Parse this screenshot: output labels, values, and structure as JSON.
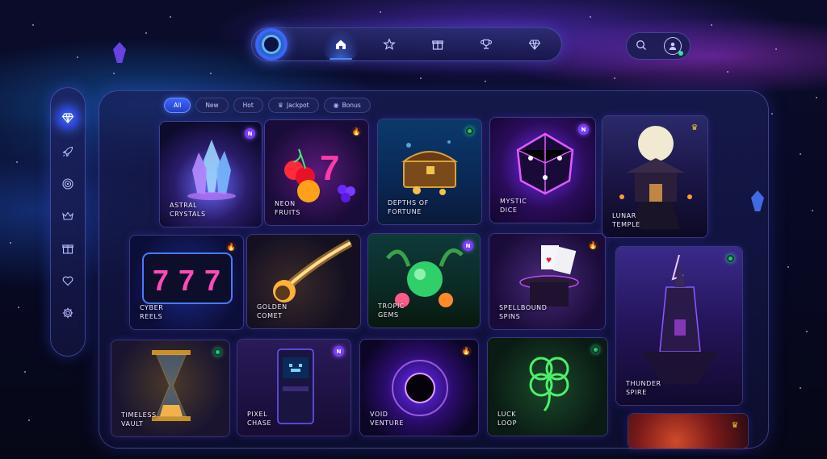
{
  "nav": {
    "items": [
      {
        "name": "home",
        "icon": "home-icon",
        "active": true
      },
      {
        "name": "favorites",
        "icon": "star-icon"
      },
      {
        "name": "gifts",
        "icon": "gift-icon"
      },
      {
        "name": "trophy",
        "icon": "trophy-icon"
      },
      {
        "name": "diamond",
        "icon": "diamond-icon"
      }
    ],
    "right": [
      "search-icon",
      "user-icon"
    ]
  },
  "sidebar": {
    "items": [
      "diamond-icon",
      "rocket-icon",
      "target-icon",
      "crown-icon",
      "gift-icon",
      "heart-icon",
      "gear-icon"
    ]
  },
  "filters": [
    {
      "label": "All",
      "active": true
    },
    {
      "label": "New"
    },
    {
      "label": "Hot"
    },
    {
      "label": "Jackpot",
      "icon": "crown-icon"
    },
    {
      "label": "Bonus",
      "icon": "coin-icon"
    }
  ],
  "games": [
    {
      "title": "ASTRAL\nCRYSTALS",
      "badge": "N",
      "badge_type": "new",
      "accent": "#6a6bff"
    },
    {
      "title": "NEON\nFRUITS",
      "badge": "🔥",
      "badge_type": "hot",
      "accent": "#ff3aa8"
    },
    {
      "title": "DEPTHS OF\nFORTUNE",
      "badge": "",
      "badge_type": "live",
      "accent": "#2a8bd8"
    },
    {
      "title": "MYSTIC\nDICE",
      "badge": "N",
      "badge_type": "new",
      "accent": "#b44bff"
    },
    {
      "title": "LUNAR\nTEMPLE",
      "badge": "♛",
      "badge_type": "crown",
      "accent": "#7a6bd0"
    },
    {
      "title": "CYBER\nREELS",
      "badge": "🔥",
      "badge_type": "hot",
      "accent": "#3a6bff"
    },
    {
      "title": "GOLDEN\nCOMET",
      "badge": "",
      "badge_type": "none",
      "accent": "#ffb23a"
    },
    {
      "title": "TROPIC\nGEMS",
      "badge": "N",
      "badge_type": "new",
      "accent": "#2fd06a"
    },
    {
      "title": "SPELLBOUND\nSPINS",
      "badge": "🔥",
      "badge_type": "hot",
      "accent": "#9a4bff"
    },
    {
      "title": "THUNDER\nSPIRE",
      "badge": "",
      "badge_type": "live",
      "accent": "#8a4bff"
    },
    {
      "title": "TIMELESS\nVAULT",
      "badge": "",
      "badge_type": "live",
      "accent": "#f0a54a"
    },
    {
      "title": "PIXEL\nCHASE",
      "badge": "N",
      "badge_type": "new",
      "accent": "#7a4bff"
    },
    {
      "title": "VOID\nVENTURE",
      "badge": "🔥",
      "badge_type": "hot",
      "accent": "#9a3bff"
    },
    {
      "title": "LUCK\nLOOP",
      "badge": "",
      "badge_type": "live",
      "accent": "#3af06a"
    },
    {
      "title": "",
      "badge": "♛",
      "badge_type": "crown",
      "accent": "#c83a2a"
    }
  ]
}
